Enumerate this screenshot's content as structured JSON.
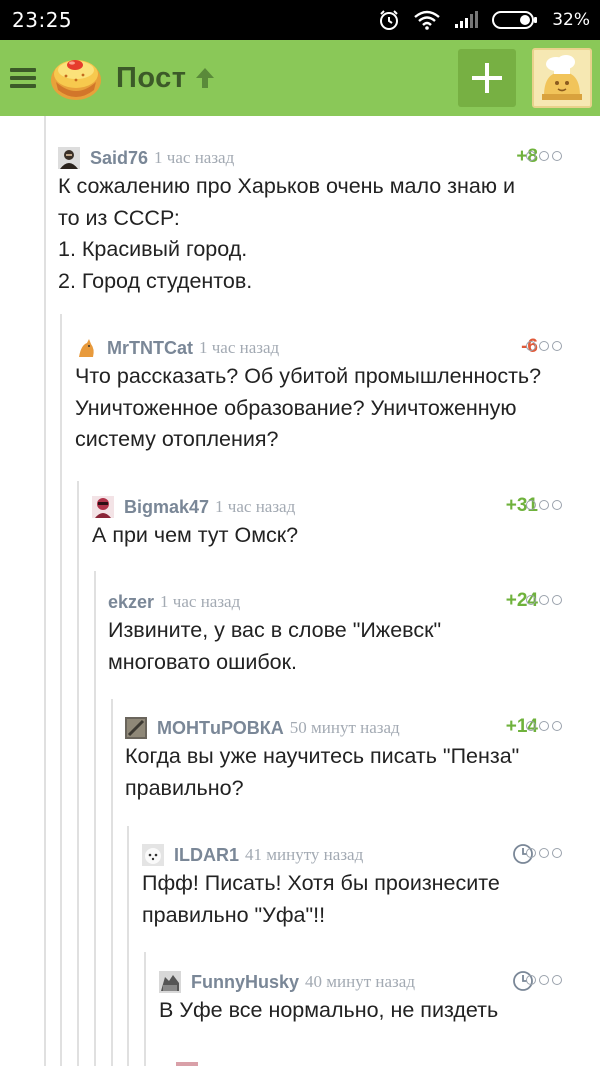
{
  "status_bar": {
    "time": "23:25",
    "battery": "32%",
    "icons": [
      "alarm-icon",
      "wifi-icon",
      "signal-icon",
      "battery-icon"
    ]
  },
  "app_bar": {
    "title": "Пост",
    "bg_color": "#8ac858",
    "title_color": "#3c5a28",
    "icons": [
      "menu-icon",
      "logo-icon",
      "up-arrow-icon",
      "add-icon",
      "user-avatar"
    ]
  },
  "comments": [
    {
      "author": "Said76",
      "time": "1 час назад",
      "score": "+8",
      "lines": [
        "К сожалению про Харьков очень мало знаю и",
        "то из СССР:",
        "1. Красивый город.",
        "2. Город студентов."
      ]
    },
    {
      "author": "MrTNTCat",
      "time": "1 час назад",
      "score": "-6",
      "lines": [
        "Что рассказать? Об убитой промышленность?",
        "Уничтоженное образование? Уничтоженную",
        "систему отопления?"
      ]
    },
    {
      "author": "Bigmak47",
      "time": "1 час назад",
      "score": "+31",
      "lines": [
        "А при чем тут Омск?"
      ]
    },
    {
      "author": "ekzer",
      "time": "1 час назад",
      "score": "+24",
      "lines": [
        "Извините, у вас в слове \"Ижевск\"",
        "многовато ошибок."
      ]
    },
    {
      "author": "МОНТuРОВКА",
      "time": "50 минут назад",
      "score": "+14",
      "lines": [
        "Когда вы уже научитесь писать \"Пенза\"",
        "правильно?"
      ]
    },
    {
      "author": "ILDAR1",
      "time": "41 минуту назад",
      "score": "",
      "lines": [
        "Пфф! Писать! Хотя бы произнесите",
        "правильно \"Уфа\"!!"
      ]
    },
    {
      "author": "FunnyHusky",
      "time": "40 минут назад",
      "score": "",
      "lines": [
        "В Уфе все нормально, не пиздеть"
      ]
    }
  ],
  "colors": {
    "score_positive": "#6fb23c",
    "score_negative": "#e05a3a",
    "author": "#7a8797",
    "time": "#a3aab3"
  }
}
